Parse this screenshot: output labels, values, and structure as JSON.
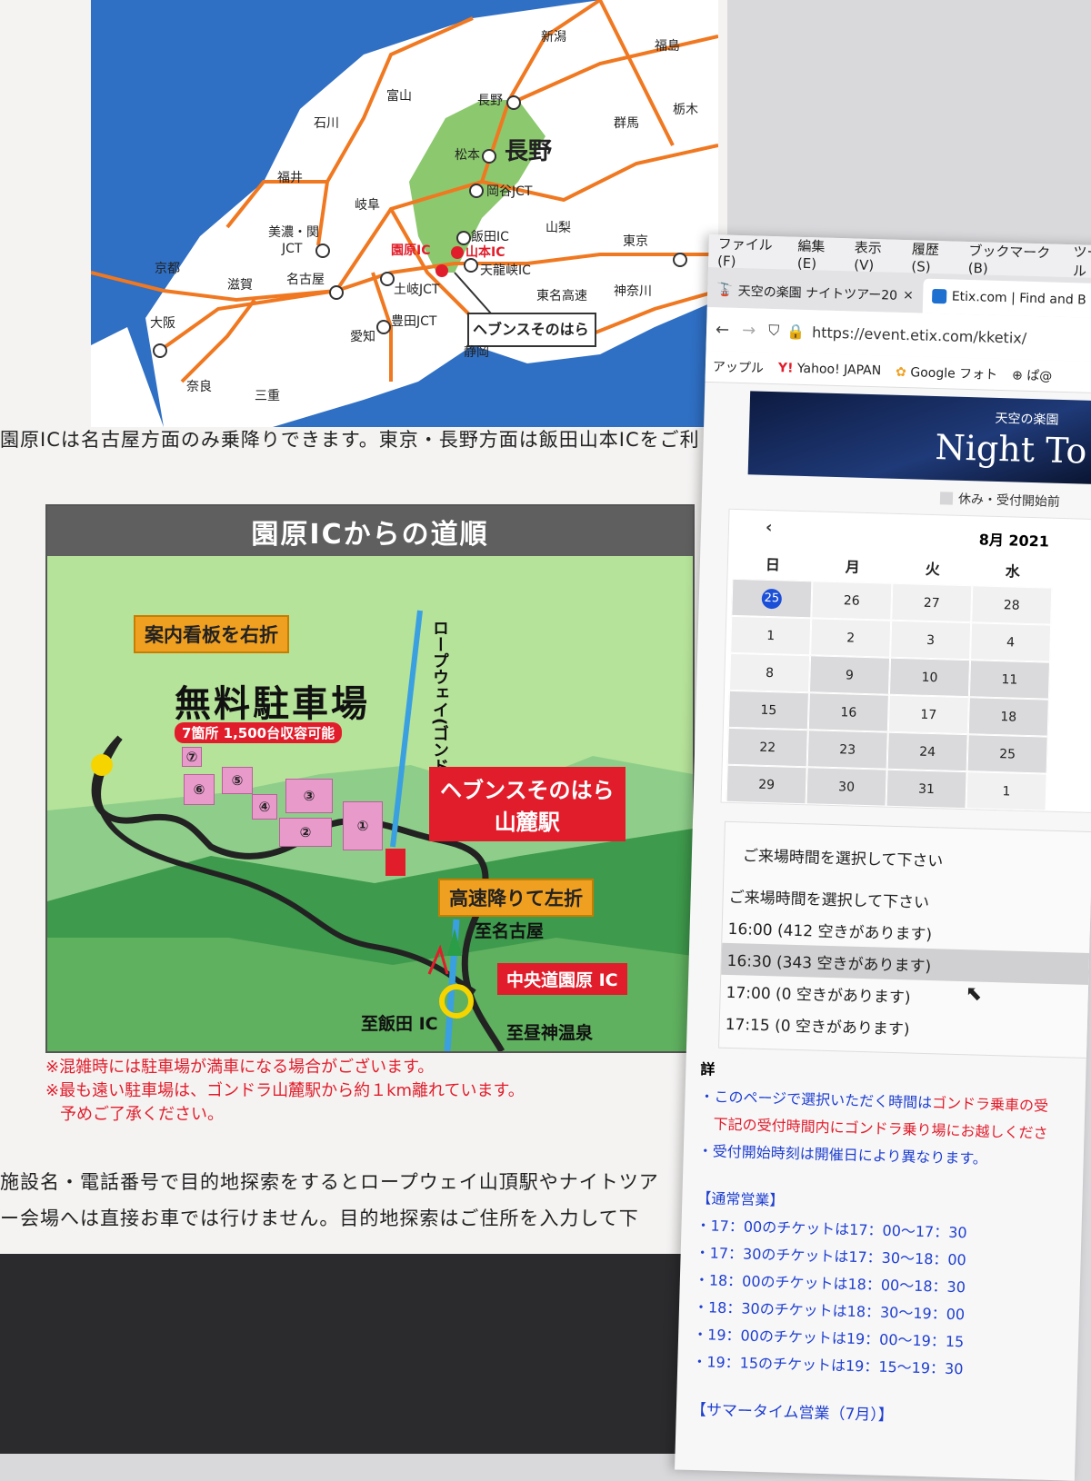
{
  "map": {
    "labels": [
      "新潟",
      "福島",
      "富山",
      "長野",
      "栃木",
      "石川",
      "群馬",
      "松本",
      "長野",
      "福井",
      "岡谷JCT",
      "岐阜",
      "山梨",
      "美濃・関",
      "JCT",
      "飯田IC",
      "東京",
      "園原IC",
      "山本IC",
      "天龍峡IC",
      "京都",
      "滋賀",
      "名古屋",
      "土岐JCT",
      "東名高速",
      "神奈川",
      "大阪",
      "豊田JCT",
      "ヘブンスそのはら",
      "愛知",
      "静岡",
      "奈良",
      "三重"
    ]
  },
  "doc": {
    "line1": "園原ICは名古屋方面のみ乗降りできます。東京・長野方面は飯田山本ICをご利",
    "line2": "施設名・電話番号で目的地探索をするとロープウェイ山頂駅やナイトツア",
    "line3": "ー会場へは直接お車では行けません。目的地探索はご住所を入力して下",
    "note1": "※混雑時には駐車場が満車になる場合がございます。",
    "note2": "※最も遠い駐車場は、ゴンドラ山麓駅から約１km離れています。",
    "note3": "予めご了承ください。"
  },
  "route": {
    "title": "園原ICからの道順",
    "turn_right": "案内看板を右折",
    "parking": "無料駐車場",
    "capacity": "7箇所 1,500台収容可能",
    "ropeway": "ロープウェイ(ゴンドラ)",
    "station_line1": "ヘブンスそのはら",
    "station_line2": "山麓駅",
    "turn_left": "高速降りて左折",
    "to_nagoya": "至名古屋",
    "interchange": "中央道園原 IC",
    "to_iida": "至飯田 IC",
    "to_hirugami": "至昼神温泉",
    "lots": [
      "①",
      "②",
      "③",
      "④",
      "⑤",
      "⑥",
      "⑦"
    ]
  },
  "browser": {
    "menu": [
      "ファイル(F)",
      "編集(E)",
      "表示(V)",
      "履歴(S)",
      "ブックマーク(B)",
      "ツール"
    ],
    "tab1": "天空の楽園 ナイトツアー20",
    "tab1_close": "×",
    "tab2": "Etix.com | Find and B",
    "url": "https://event.etix.com/kketix/",
    "bookmarks": [
      "アップル",
      "Yahoo! JAPAN",
      "Google フォト",
      "ぱ@"
    ],
    "banner_sub": "天空の楽園",
    "banner_title": "Night To",
    "legend": "休み・受付開始前"
  },
  "calendar": {
    "prev": "‹",
    "month": "8月 2021",
    "dow": [
      "日",
      "月",
      "火",
      "水"
    ],
    "rows": [
      [
        "25",
        "26",
        "27",
        "28"
      ],
      [
        "1",
        "2",
        "3",
        "4"
      ],
      [
        "8",
        "9",
        "10",
        "11"
      ],
      [
        "15",
        "16",
        "17",
        "18"
      ],
      [
        "22",
        "23",
        "24",
        "25"
      ],
      [
        "29",
        "30",
        "31",
        "1"
      ]
    ]
  },
  "times": {
    "title": "ご来場時間を選択して下さい",
    "options": [
      "ご来場時間を選択して下さい",
      "16:00 (412 空きがあります)",
      "16:30 (343 空きがあります)",
      "17:00 (0 空きがあります)",
      "17:15 (0 空きがあります)"
    ]
  },
  "info": {
    "detail": "詳",
    "b1a": "・このページで選択いただく時間は",
    "b1b": "ゴンドラ乗車の受",
    "b1c": "下記の受付時間内にゴンドラ乗り場にお越しくださ",
    "b2": "・受付開始時刻は開催日により異なります。",
    "normal_head": "【通常営業】",
    "schedule": [
      "・17：00のチケットは17：00〜17：30",
      "・17：30のチケットは17：30〜18：00",
      "・18：00のチケットは18：00〜18：30",
      "・18：30のチケットは18：30〜19：00",
      "・19：00のチケットは19：00〜19：15",
      "・19：15のチケットは19：15〜19：30"
    ],
    "summer_head": "【サマータイム営業（7月）】"
  },
  "colors": {
    "sea": "#2f6fc4",
    "land": "#ffffff",
    "nagano": "#8cc86e",
    "road": "#f07820",
    "alert": "#e21d2b",
    "link": "#1f3fd0"
  }
}
